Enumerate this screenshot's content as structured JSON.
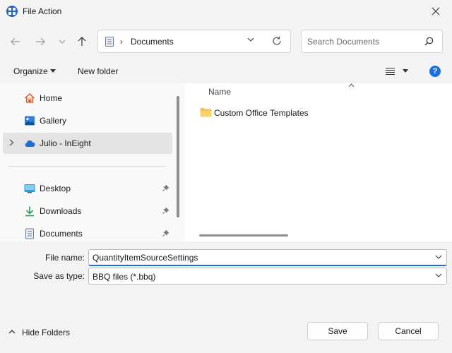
{
  "window": {
    "title": "File Action"
  },
  "address": {
    "segment": "Documents",
    "separator": "›"
  },
  "search": {
    "placeholder": "Search Documents"
  },
  "toolbar": {
    "organize_label": "Organize",
    "new_folder_label": "New folder",
    "help_label": "?"
  },
  "sidebar": {
    "items": [
      {
        "label": "Home",
        "icon": "home-icon"
      },
      {
        "label": "Gallery",
        "icon": "gallery-icon"
      },
      {
        "label": "Julio - InEight",
        "icon": "cloud-icon",
        "selected": true
      },
      {
        "label": "Desktop",
        "icon": "desktop-icon",
        "pinned": true
      },
      {
        "label": "Downloads",
        "icon": "download-icon",
        "pinned": true
      },
      {
        "label": "Documents",
        "icon": "documents-icon",
        "pinned": true
      }
    ]
  },
  "content": {
    "column_header": "Name",
    "files": [
      {
        "name": "Custom Office Templates",
        "type": "folder"
      }
    ]
  },
  "form": {
    "filename_label": "File name:",
    "filename_value": "QuantityItemSourceSettings",
    "savetype_label": "Save as type:",
    "savetype_value": "BBQ files (*.bbq)"
  },
  "footer": {
    "hide_folders_label": "Hide Folders",
    "save_label": "Save",
    "cancel_label": "Cancel"
  },
  "colors": {
    "accent": "#1a6fdc",
    "folder": "#f2c24b",
    "cloud": "#1e6fd6"
  }
}
